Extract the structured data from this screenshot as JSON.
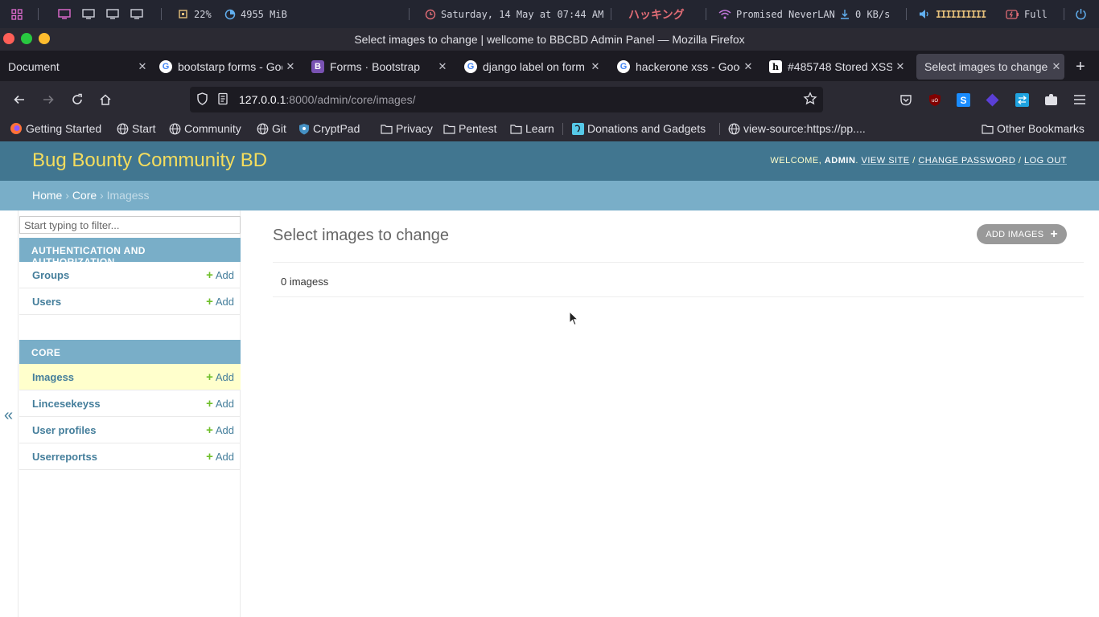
{
  "system_bar": {
    "cpu": "22%",
    "memory": "4955 MiB",
    "datetime": "Saturday, 14 May at 07:44 AM",
    "hacking_label": "ハッキング",
    "network": "Promised NeverLAN",
    "download": "0 KB/s",
    "volume_bars": "IIIIIIIIII",
    "battery": "Full"
  },
  "window_title": "Select images to change | wellcome to BBCBD Admin Panel — Mozilla Firefox",
  "tabs": [
    {
      "label": "Document"
    },
    {
      "label": "bootstarp forms - Google Search"
    },
    {
      "label": "Forms · Bootstrap"
    },
    {
      "label": "django label on form - Google Search"
    },
    {
      "label": "hackerone xss - Google Search"
    },
    {
      "label": "#485748 Stored XSS"
    },
    {
      "label": "Select images to change"
    }
  ],
  "url": {
    "host": "127.0.0.1",
    "rest": ":8000/admin/core/images/"
  },
  "bookmarks": [
    {
      "label": "Getting Started"
    },
    {
      "label": "Start"
    },
    {
      "label": "Community"
    },
    {
      "label": "Git"
    },
    {
      "label": "CryptPad"
    },
    {
      "label": "Privacy"
    },
    {
      "label": "Pentest"
    },
    {
      "label": "Learn"
    },
    {
      "label": "Donations and Gadgets"
    },
    {
      "label": "view-source:https://pp...."
    },
    {
      "label": "Other Bookmarks"
    }
  ],
  "admin": {
    "branding": "Bug Bounty Community BD",
    "welcome": "Welcome,",
    "username": "admin",
    "view_site": "View site",
    "change_password": "Change password",
    "log_out": "Log out",
    "breadcrumbs": {
      "home": "Home",
      "core": "Core",
      "current": "Imagess"
    },
    "filter_placeholder": "Start typing to filter...",
    "modules": [
      {
        "caption": "Authentication and Authorization",
        "models": [
          "Groups",
          "Users"
        ]
      },
      {
        "caption": "Core",
        "models": [
          "Imagess",
          "Lincesekeyss",
          "User profiles",
          "Userreportss"
        ]
      }
    ],
    "add_label": "Add",
    "page_title": "Select images to change",
    "add_button": "Add Images",
    "result_count": "0 imagess"
  }
}
